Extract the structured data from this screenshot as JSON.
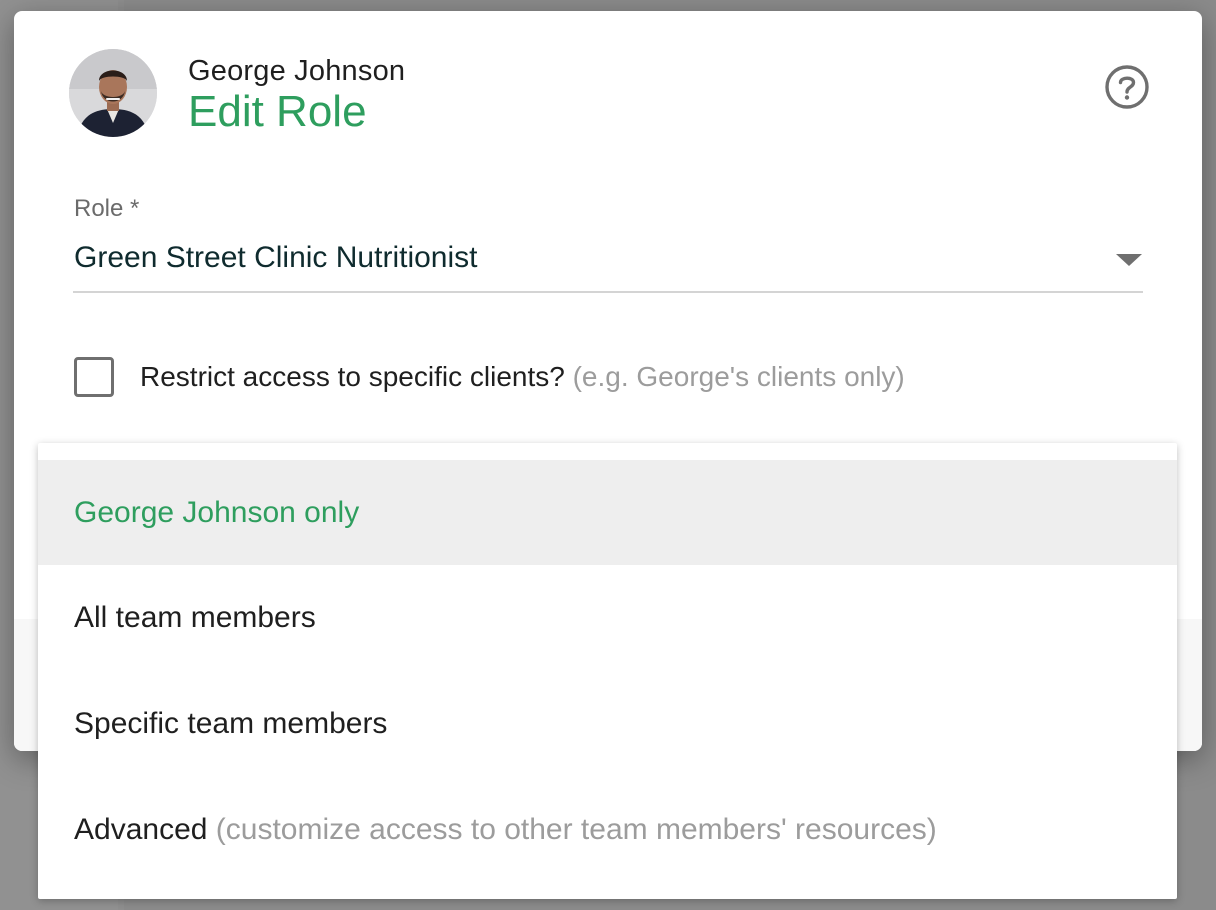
{
  "header": {
    "user_name": "George Johnson",
    "title": "Edit Role",
    "help_icon": "help-circle-icon",
    "avatar": "avatar-photo"
  },
  "role": {
    "label": "Role *",
    "value": "Green Street Clinic Nutritionist",
    "dropdown_icon": "caret-down-icon"
  },
  "restrict": {
    "checked": false,
    "label": "Restrict access to specific clients?",
    "hint": "(e.g. George's clients only)"
  },
  "menu": {
    "items": [
      {
        "label": "George Johnson only",
        "hint": "",
        "selected": true
      },
      {
        "label": "All team members",
        "hint": "",
        "selected": false
      },
      {
        "label": "Specific team members",
        "hint": "",
        "selected": false
      },
      {
        "label": "Advanced",
        "hint": "(customize access to other team members' resources)",
        "selected": false
      }
    ]
  },
  "colors": {
    "accent": "#2e9e5e",
    "text": "#1f1f1f",
    "muted": "#9c9c9c",
    "selected_bg": "#eeeeee"
  }
}
